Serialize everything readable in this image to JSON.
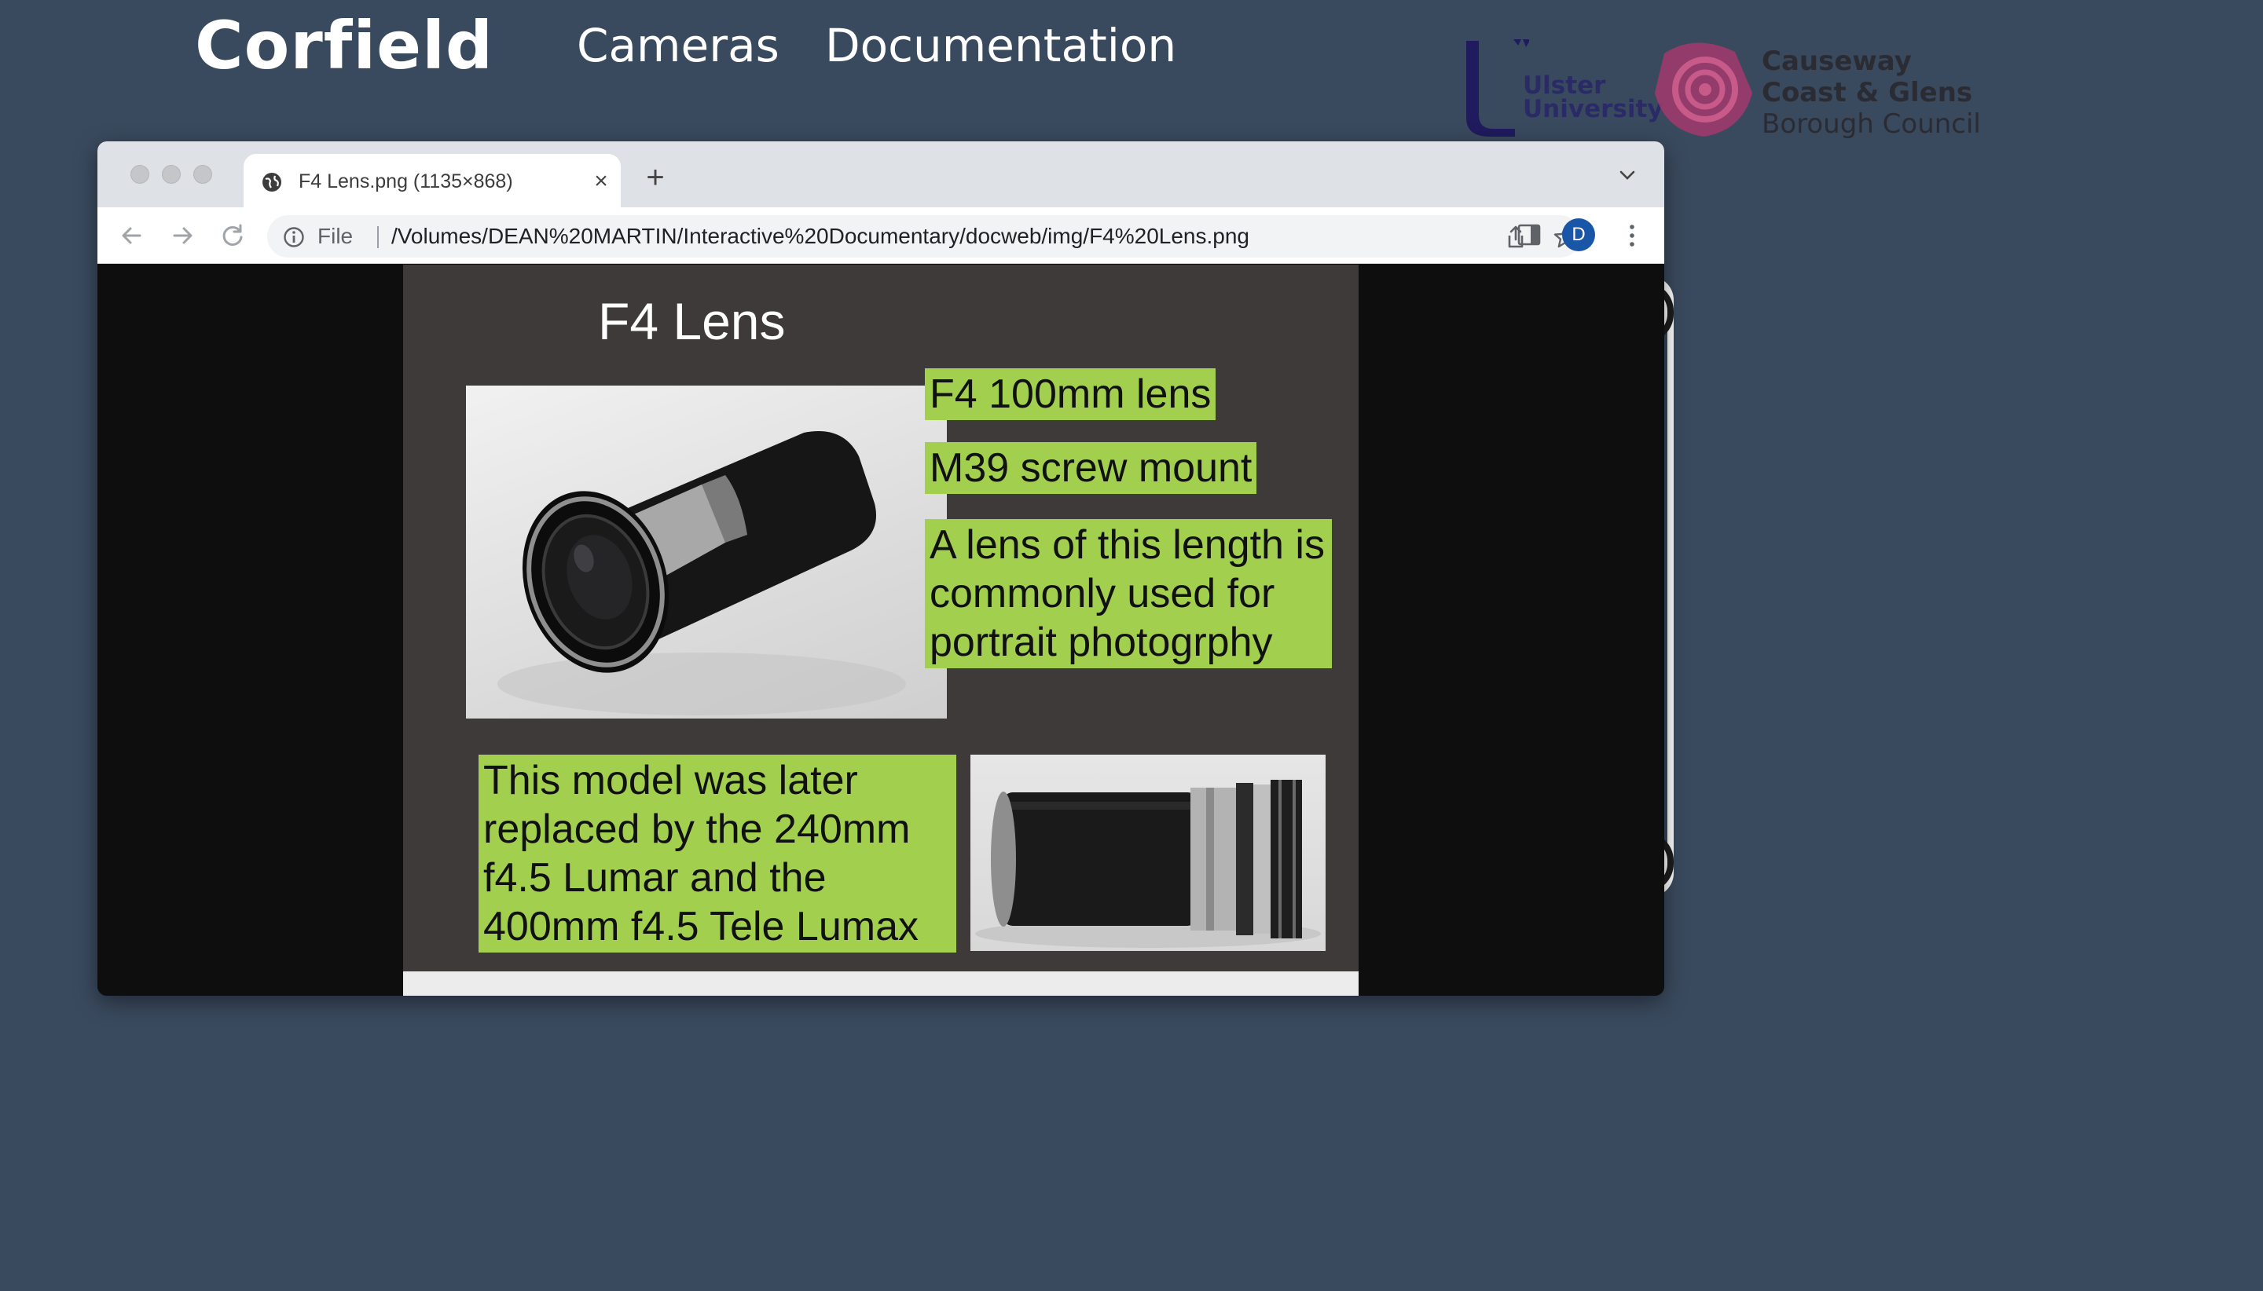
{
  "site": {
    "brand": "Corfield",
    "nav": [
      "Cameras",
      "Documentation"
    ]
  },
  "logos": {
    "ulster": [
      "Ulster",
      "University"
    ],
    "council": [
      "Causeway",
      "Coast & Glens",
      "Borough Council"
    ]
  },
  "browser": {
    "tab_title": "F4 Lens.png (1135×868)",
    "new_tab_label": "+",
    "scheme_label": "File",
    "url": "/Volumes/DEAN%20MARTIN/Interactive%20Documentary/docweb/img/F4%20Lens.png",
    "profile_initial": "D"
  },
  "slide": {
    "title": "F4 Lens",
    "labels": [
      "F4 100mm lens",
      "M39 screw mount",
      "A lens of this length is\ncommonly used for\nportrait photogrphy",
      "This model was later\nreplaced by the 240mm\nf4.5 Lumar and the\n400mm f4.5 Tele Lumax"
    ]
  },
  "colors": {
    "page_bg": "#3a4a5e",
    "label_green": "#a3cf4e",
    "slide_bg": "#3e3a39"
  }
}
